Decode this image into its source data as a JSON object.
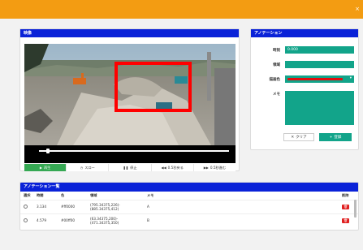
{
  "topbar": {
    "close_glyph": "×",
    "color": "#f39c12"
  },
  "video": {
    "header": "映像",
    "controls": [
      {
        "icon": "play-icon",
        "glyph": "▶",
        "label": "再生"
      },
      {
        "icon": "slow-icon",
        "glyph": "◷",
        "label": "スロー"
      },
      {
        "icon": "pause-icon",
        "glyph": "❚❚",
        "label": "停止"
      },
      {
        "icon": "rewind-icon",
        "glyph": "◀◀",
        "label": "0.5秒戻る"
      },
      {
        "icon": "forward-icon",
        "glyph": "▶▶",
        "label": "0.5秒進む"
      }
    ],
    "seek_fraction": 0.04
  },
  "annotation": {
    "header": "アノテーション",
    "time_label": "時刻",
    "time_value": "0.000",
    "region_label": "領域",
    "region_value": "",
    "color_label": "描画色",
    "color_value": "#e01010",
    "memo_label": "メモ",
    "memo_value": "",
    "clear_label": "クリア",
    "clear_glyph": "✕",
    "save_label": "登録",
    "save_glyph": "+"
  },
  "list": {
    "header": "アノテーション一覧",
    "columns": [
      "選択",
      "時間",
      "色",
      "領域",
      "メモ",
      "削除"
    ],
    "rows": [
      {
        "time": "3.134",
        "color": "#ff0000",
        "region_line1": "(795.34375,226)-",
        "region_line2": "(885.34375,412)",
        "memo": "A"
      },
      {
        "time": "4.579",
        "color": "#00ff00",
        "region_line1": "(63.34375,200)-",
        "region_line2": "(471.34375,350)",
        "memo": "B"
      }
    ],
    "delete_glyph": "🗑"
  }
}
